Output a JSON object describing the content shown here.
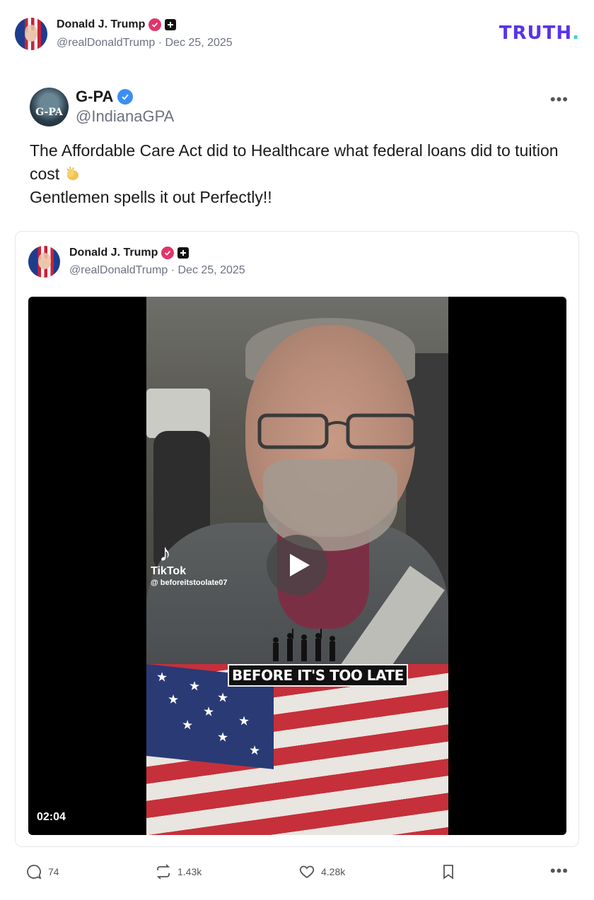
{
  "header": {
    "author_name": "Donald J. Trump",
    "author_handle": "@realDonaldTrump",
    "separator": "·",
    "date": "Dec 25, 2025",
    "logo_text": "TRUTH",
    "logo_dot": "."
  },
  "original_post": {
    "avatar_text": "G-PA",
    "author_name": "G-PA",
    "author_handle": "@IndianaGPA",
    "more_label": "•••",
    "text_line1": "The Affordable Care Act did to Healthcare what federal loans did to tuition cost",
    "text_line2": "Gentlemen spells it out Perfectly!!",
    "emoji_icon": "clapping-hands-icon"
  },
  "quoted_post": {
    "author_name": "Donald J. Trump",
    "author_handle": "@realDonaldTrump",
    "separator": "·",
    "date": "Dec 25, 2025",
    "video": {
      "duration": "02:04",
      "watermark_brand": "TikTok",
      "watermark_user": "@ beforeitstoolate07",
      "banner_text": "BEFORE IT'S TOO LATE"
    }
  },
  "actions": {
    "replies": "74",
    "retruths": "1.43k",
    "likes": "4.28k",
    "more_label": "•••"
  },
  "colors": {
    "truth_logo": "#5b33e6",
    "truth_dot": "#37d3c4",
    "verified_badge": "#e0356b",
    "blue_check": "#3b8ff3"
  }
}
